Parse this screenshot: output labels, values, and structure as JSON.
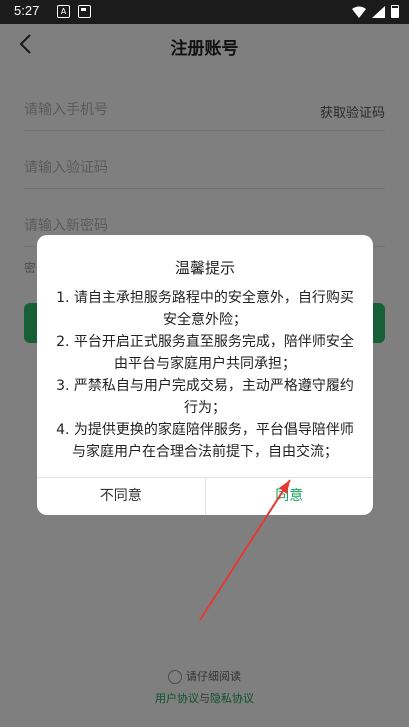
{
  "status_bar": {
    "time": "5:27",
    "icon_a": "A"
  },
  "header": {
    "title": "注册账号"
  },
  "form": {
    "phone_placeholder": "请输入手机号",
    "get_code_label": "获取验证码",
    "code_placeholder": "请输入验证码",
    "password_placeholder": "请输入新密码",
    "hint_text": "密"
  },
  "agreement": {
    "read_label": "请仔细阅读",
    "user_agreement": "用户协议",
    "and": "与",
    "privacy_policy": "隐私协议"
  },
  "dialog": {
    "title": "温馨提示",
    "items": [
      "1. 请自主承担服务路程中的安全意外，自行购买安全意外险；",
      "2. 平台开启正式服务直至服务完成，陪伴师安全由平台与家庭用户共同承担；",
      "3. 严禁私自与用户完成交易，主动严格遵守履约行为；",
      "4. 为提供更换的家庭陪伴服务，平台倡导陪伴师与家庭用户在合理合法前提下，自由交流；"
    ],
    "disagree_label": "不同意",
    "agree_label": "同意"
  },
  "colors": {
    "accent": "#1aa35b",
    "annotation": "#e53935"
  }
}
